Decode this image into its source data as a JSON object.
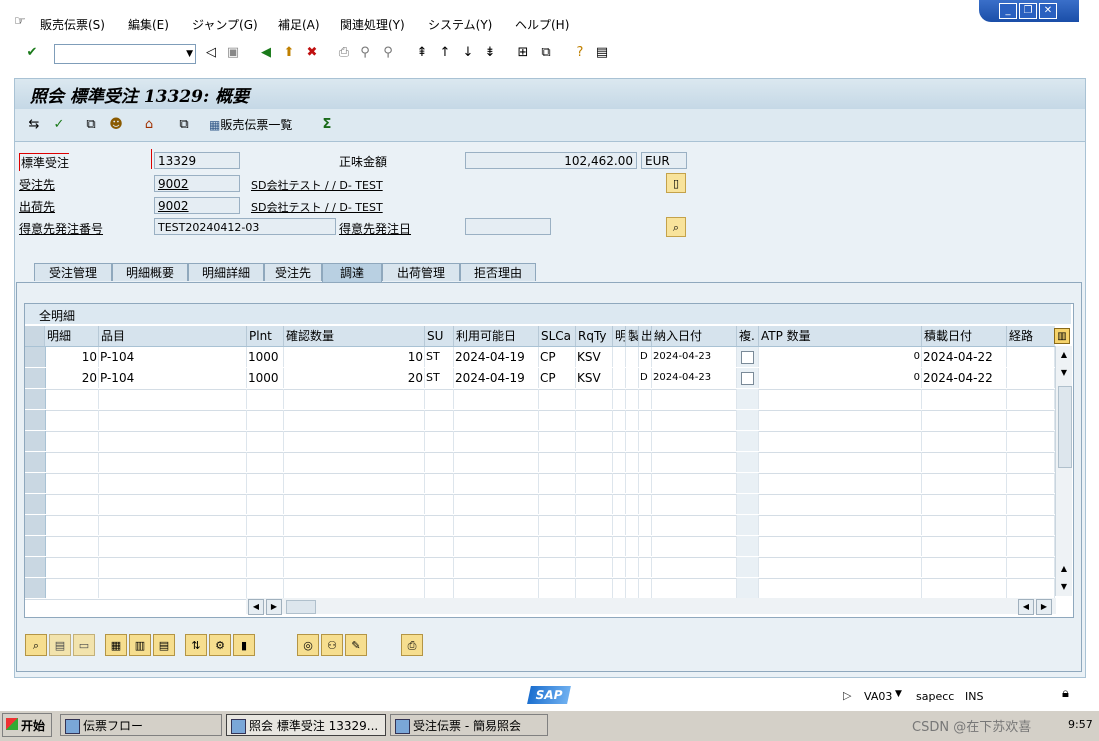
{
  "menu": [
    "販売伝票(S)",
    "編集(E)",
    "ジャンプ(G)",
    "補足(A)",
    "関連処理(Y)",
    "システム(Y)",
    "ヘルプ(H)"
  ],
  "window_controls": [
    "_",
    "❐",
    "✕"
  ],
  "title": "照会 標準受注 13329: 概要",
  "app_toolbar": {
    "sales_doc_list": "販売伝票一覧"
  },
  "header": {
    "doc_type_label": "標準受注",
    "doc_number": "13329",
    "net_value_label": "正味金額",
    "net_value": "102,462.00",
    "currency": "EUR",
    "sold_to_label": "受注先",
    "sold_to": "9002",
    "sold_to_name": "SD会社テスト / / D- TEST",
    "ship_to_label": "出荷先",
    "ship_to": "9002",
    "ship_to_name": "SD会社テスト / / D- TEST",
    "po_number_label": "得意先発注番号",
    "po_number": "TEST20240412-03",
    "po_date_label": "得意先発注日",
    "po_date": ""
  },
  "tabs": [
    "受注管理",
    "明細概要",
    "明細詳細",
    "受注先",
    "調達",
    "出荷管理",
    "拒否理由"
  ],
  "active_tab": "調達",
  "table": {
    "caption": "全明細",
    "columns": [
      "明細",
      "品目",
      "Plnt",
      "確認数量",
      "SU",
      "利用可能日",
      "SLCa",
      "RqTy",
      "明",
      "製",
      "出",
      "納入日付",
      "複.",
      "ATP 数量",
      "積載日付",
      "経路"
    ],
    "rows": [
      [
        "10",
        "P-104",
        "1000",
        "10",
        "ST",
        "2024-04-19",
        "CP",
        "KSV",
        "",
        "",
        "D",
        "2024-04-23",
        "",
        "0",
        "2024-04-22",
        ""
      ],
      [
        "20",
        "P-104",
        "1000",
        "20",
        "ST",
        "2024-04-19",
        "CP",
        "KSV",
        "",
        "",
        "D",
        "2024-04-23",
        "",
        "0",
        "2024-04-22",
        ""
      ]
    ]
  },
  "status": {
    "transaction": "VA03",
    "server": "sapecc",
    "mode": "INS",
    "logo": "SAP"
  },
  "taskbar": {
    "start": "开始",
    "tasks": [
      "伝票フロー",
      "照会 標準受注 13329...",
      "受注伝票 - 簡易照会"
    ],
    "clock": "9:57",
    "watermark": "CSDN @在下苏欢喜"
  },
  "colors": {
    "title_band": "#c5d8e6",
    "panel": "#eaf1f6",
    "tab_active": "#b9d0e2"
  }
}
